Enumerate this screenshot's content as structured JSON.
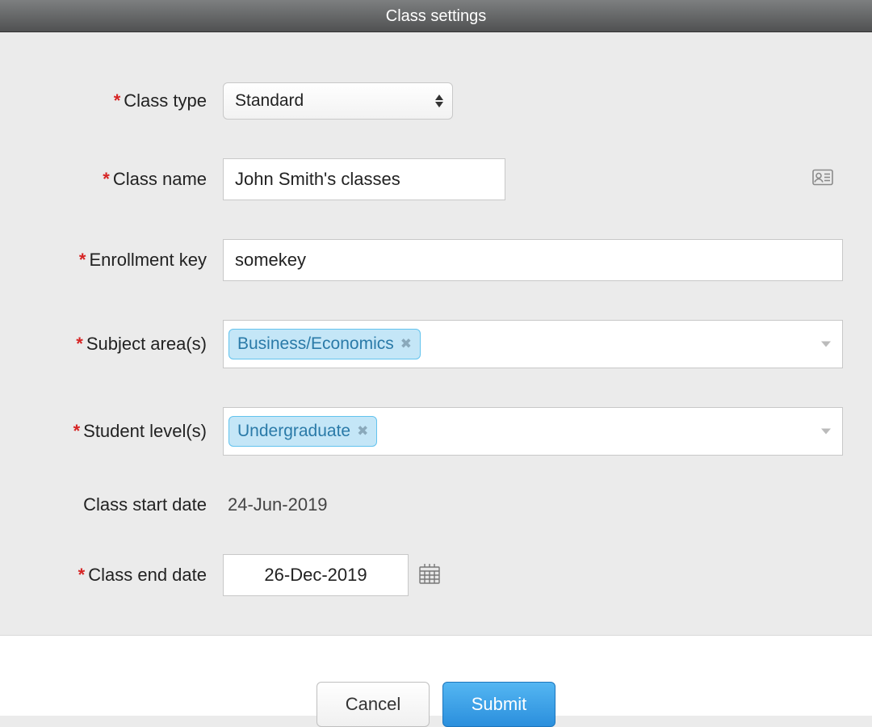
{
  "header": {
    "title": "Class settings"
  },
  "labels": {
    "class_type": "Class type",
    "class_name": "Class name",
    "enrollment_key": "Enrollment key",
    "subject_areas": "Subject area(s)",
    "student_levels": "Student level(s)",
    "start_date": "Class start date",
    "end_date": "Class end date"
  },
  "fields": {
    "class_type": {
      "value": "Standard"
    },
    "class_name": {
      "value": "John Smith's classes"
    },
    "enrollment_key": {
      "value": "somekey"
    },
    "subject_areas": {
      "tags": [
        "Business/Economics"
      ]
    },
    "student_levels": {
      "tags": [
        "Undergraduate"
      ]
    },
    "start_date": "24-Jun-2019",
    "end_date": "26-Dec-2019"
  },
  "footer": {
    "cancel": "Cancel",
    "submit": "Submit"
  }
}
